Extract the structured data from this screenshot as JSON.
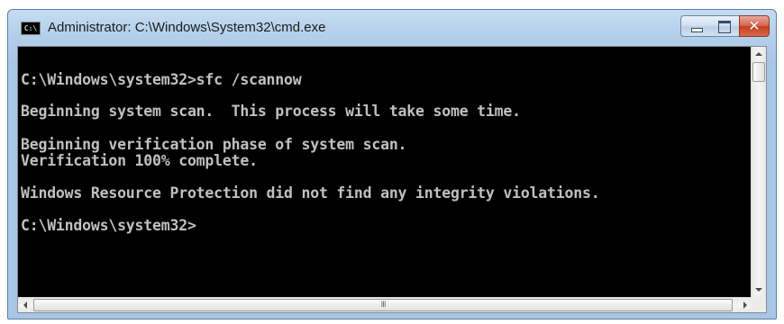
{
  "window": {
    "title": "Administrator: C:\\Windows\\System32\\cmd.exe",
    "icon": "cmd-icon",
    "icon_text": "C:\\"
  },
  "controls": {
    "minimize": "minimize-icon",
    "maximize": "maximize-icon",
    "close": "close-icon",
    "close_glyph": "✕"
  },
  "console": {
    "lines": [
      "C:\\Windows\\system32>sfc /scannow",
      "Beginning system scan.  This process will take some time.",
      "Beginning verification phase of system scan.",
      "Verification 100% complete.",
      "Windows Resource Protection did not find any integrity violations.",
      "C:\\Windows\\system32>"
    ]
  },
  "scrollbar": {
    "grip": "III"
  }
}
